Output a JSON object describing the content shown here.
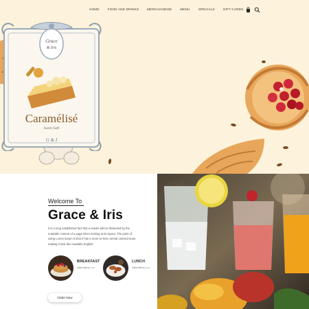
{
  "nav": {
    "items": [
      "HOME",
      "FOOD AND DRINKS",
      "MERCHANDISE",
      "MENU",
      "SPECIALS",
      "GIFT CARDS"
    ],
    "cart_icon": "shopping-bag-icon",
    "search_icon": "search-icon"
  },
  "logo": {
    "top_text_line1": "Grace",
    "top_text_line2": "& Iris",
    "name": "Caramélisé",
    "tagline": "Sweet Café",
    "monogram": "G & I"
  },
  "welcome": {
    "eyebrow": "Welcome To",
    "title": "Grace & Iris",
    "description": "It is a long established fact that a reader will be distracted by the readable content of a page when looking at its layout. The point of using Lorem Ipsum is that it has a more-or-less normal ordered team, making it look like readable English."
  },
  "menu_cards": [
    {
      "title": "BREAKFAST",
      "link": "View Menu >>>"
    },
    {
      "title": "LUNCH",
      "link": "View Menu >>>"
    }
  ],
  "cta": {
    "label": "Order Now"
  },
  "colors": {
    "cream": "#fdf3dc",
    "accent": "#8a5a2b",
    "frame": "#9aa9b8"
  }
}
